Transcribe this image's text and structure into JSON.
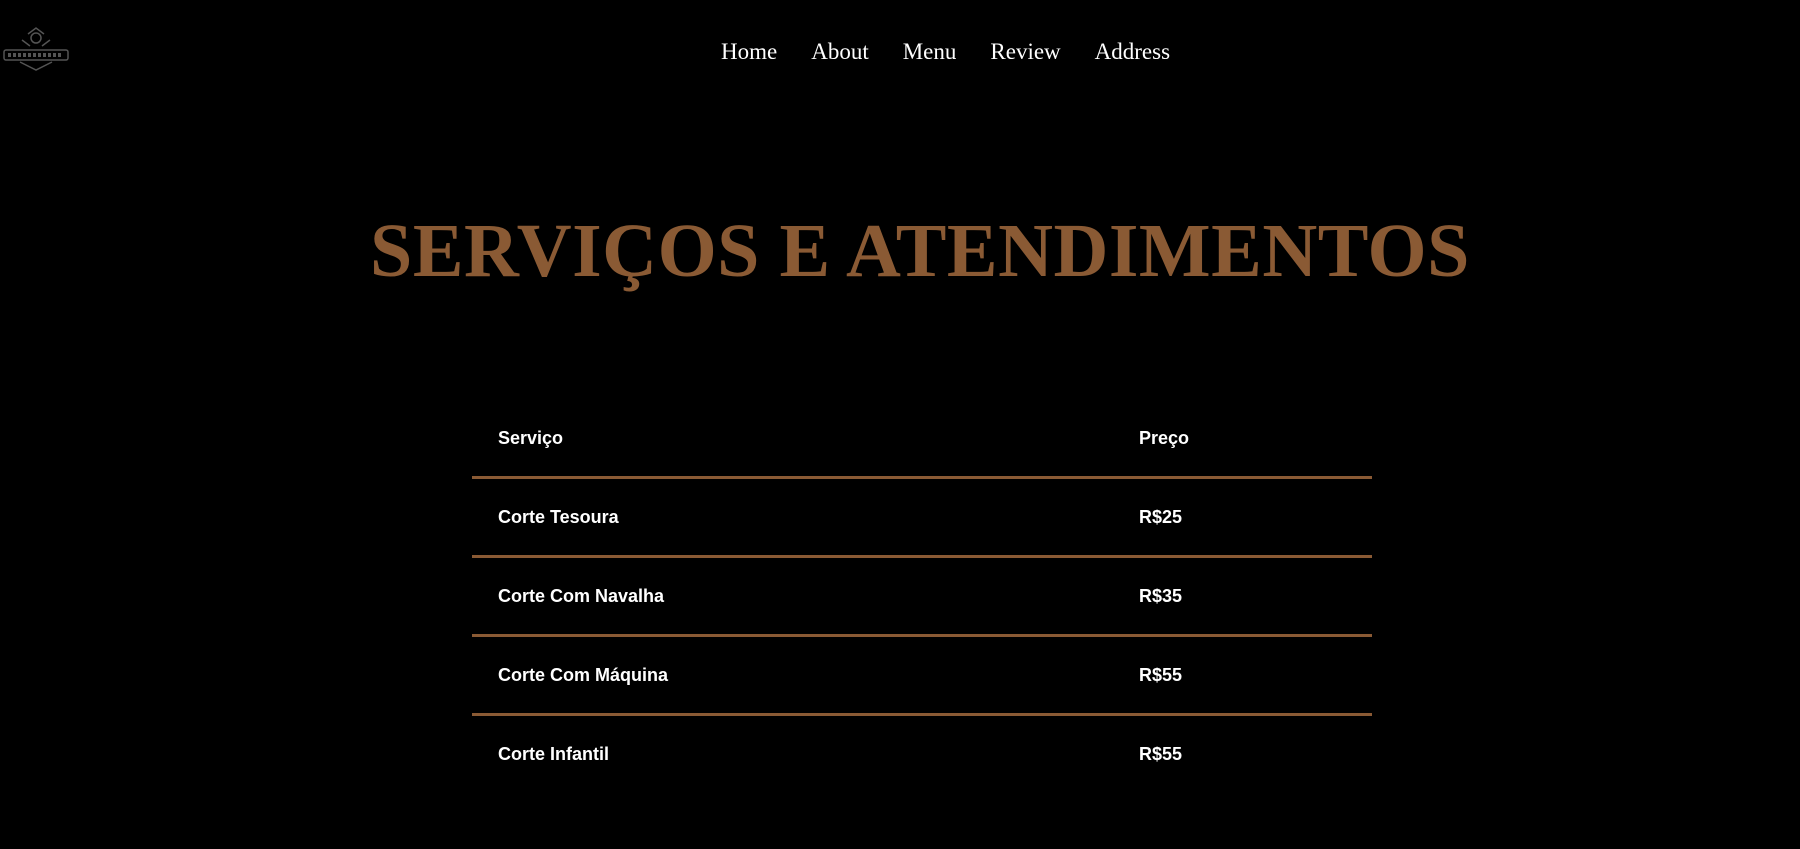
{
  "header": {
    "logo_icon": "barbershop-logo",
    "nav": [
      {
        "label": "Home"
      },
      {
        "label": "About"
      },
      {
        "label": "Menu"
      },
      {
        "label": "Review"
      },
      {
        "label": "Address"
      }
    ]
  },
  "main": {
    "title": "SERVIÇOS E ATENDIMENTOS",
    "table": {
      "columns": [
        "Serviço",
        "Preço"
      ],
      "rows": [
        {
          "service": "Corte Tesoura",
          "price": "R$25"
        },
        {
          "service": "Corte Com Navalha",
          "price": "R$35"
        },
        {
          "service": "Corte Com Máquina",
          "price": "R$55"
        },
        {
          "service": "Corte Infantil",
          "price": "R$55"
        }
      ]
    }
  },
  "colors": {
    "background": "#000000",
    "accent": "#8a5a34",
    "text": "#ffffff"
  }
}
